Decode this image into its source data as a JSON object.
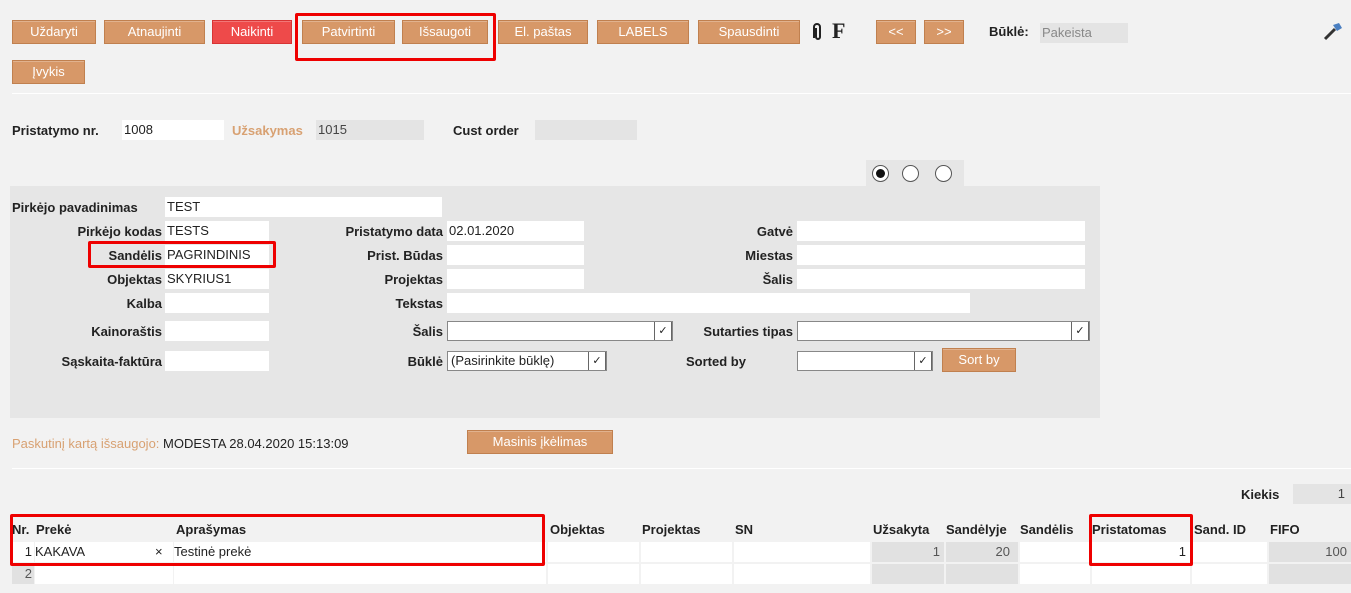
{
  "toolbar": {
    "close": "Uždaryti",
    "refresh": "Atnaujinti",
    "cancel": "Naikinti",
    "confirm": "Patvirtinti",
    "save": "Išsaugoti",
    "email": "El. paštas",
    "labels": "LABELS",
    "print": "Spausdinti",
    "f_label": "F",
    "prev": "<<",
    "next": ">>",
    "status_label": "Būklė:",
    "status_value": "Pakeista",
    "event": "Įvykis"
  },
  "header": {
    "delivery_no_label": "Pristatymo nr.",
    "delivery_no": "1008",
    "order_label": "Užsakymas",
    "order_no": "1015",
    "cust_order_label": "Cust order",
    "cust_order": ""
  },
  "form": {
    "buyer_name_label": "Pirkėjo pavadinimas",
    "buyer_name": "TEST",
    "buyer_code_label": "Pirkėjo kodas",
    "buyer_code": "TESTS",
    "warehouse_label": "Sandėlis",
    "warehouse": "PAGRINDINIS",
    "object_label": "Objektas",
    "object": "SKYRIUS1",
    "language_label": "Kalba",
    "language": "",
    "pricelist_label": "Kainoraštis",
    "pricelist": "",
    "invoice_label": "Sąskaita-faktūra",
    "invoice": "",
    "delivery_date_label": "Pristatymo data",
    "delivery_date": "02.01.2020",
    "delivery_method_label": "Prist. Būdas",
    "project_label": "Projektas",
    "text_label": "Tekstas",
    "country_label": "Šalis",
    "status_label": "Būklė",
    "status_select": "(Pasirinkite būklę)",
    "street_label": "Gatvė",
    "city_label": "Miestas",
    "country2_label": "Šalis",
    "contract_type_label": "Sutarties tipas",
    "sorted_by_label": "Sorted by",
    "sort_by_button": "Sort by"
  },
  "footer": {
    "last_saved_label": "Paskutinį kartą išsaugojo:",
    "last_saved_value": "MODESTA 28.04.2020 15:13:09",
    "mass_import": "Masinis įkėlimas",
    "quantity_label": "Kiekis",
    "quantity_value": "1"
  },
  "table": {
    "headers": {
      "nr": "Nr.",
      "item": "Prekė",
      "description": "Aprašymas",
      "object": "Objektas",
      "project": "Projektas",
      "sn": "SN",
      "ordered": "Užsakyta",
      "in_warehouse": "Sandėlyje",
      "warehouse": "Sandėlis",
      "delivering": "Pristatomas",
      "wh_id": "Sand. ID",
      "fifo": "FIFO"
    },
    "rows": [
      {
        "nr": "1",
        "item": "KAKAVA",
        "remove": "×",
        "description": "Testinė prekė",
        "ordered": "1",
        "in_warehouse": "20",
        "delivering": "1",
        "fifo": "100"
      },
      {
        "nr": "2",
        "item": "",
        "remove": "",
        "description": "",
        "ordered": "",
        "in_warehouse": "",
        "delivering": "",
        "fifo": ""
      }
    ]
  },
  "colors": {
    "button": "#d79868",
    "button_danger": "#ee4a4a",
    "highlight": "#ee0000",
    "label_orange": "#d8a172"
  }
}
